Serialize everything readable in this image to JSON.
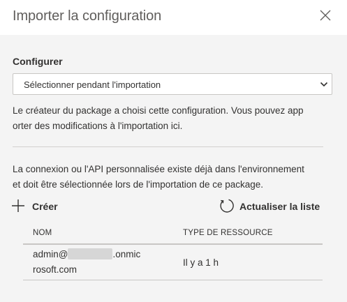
{
  "dialog": {
    "title": "Importer la configuration",
    "close_icon": "close-icon"
  },
  "configure": {
    "label": "Configurer",
    "select_value": "Sélectionner pendant l'importation",
    "select_icon": "chevron-down-icon",
    "description_lines": [
      "Le créateur du package a choisi cette configuration. Vous pouvez app",
      "orter des modifications à l'importation ici."
    ]
  },
  "connection": {
    "description_lines": [
      "La connexion ou l'API personnalisée existe déjà dans l'environnement",
      "et doit être sélectionnée lors de l'importation de ce package."
    ],
    "create_label": "Créer",
    "create_icon": "plus-icon",
    "refresh_label": "Actualiser la liste",
    "refresh_icon": "refresh-icon"
  },
  "table": {
    "columns": [
      "NOM",
      "TYPE DE RESSOURCE"
    ],
    "rows": [
      {
        "name_prefix": "admin@",
        "name_suffix": ".onmic",
        "name_line2": "rosoft.com",
        "type": "Il y a 1 h"
      }
    ]
  },
  "colors": {
    "background": "#f4f4f4",
    "header": "#ffffff",
    "text": "#323130",
    "border": "#c8c6c4"
  }
}
